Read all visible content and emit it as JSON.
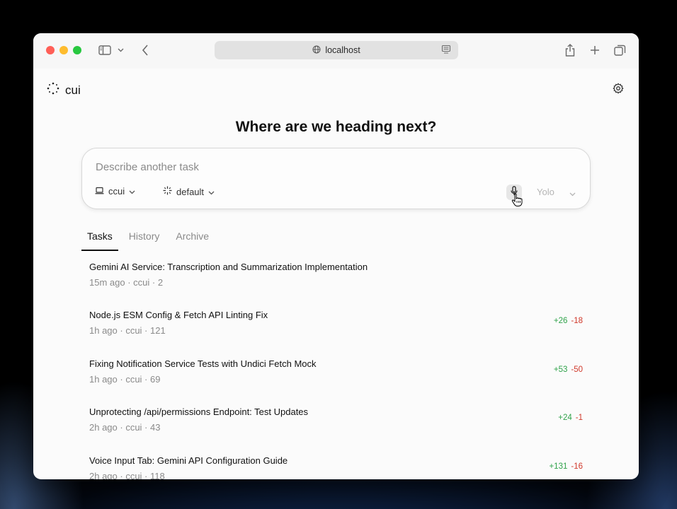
{
  "browser": {
    "url": "localhost"
  },
  "app": {
    "logo_text": "cui",
    "heading": "Where are we heading next?"
  },
  "composer": {
    "placeholder": "Describe another task",
    "project": "ccui",
    "model": "default",
    "mode": "Yolo"
  },
  "tabs": [
    "Tasks",
    "History",
    "Archive"
  ],
  "tasks": [
    {
      "title": "Gemini AI Service: Transcription and Summarization Implementation",
      "meta": "15m ago · ccui · 2",
      "additions": "",
      "deletions": ""
    },
    {
      "title": "Node.js ESM Config & Fetch API Linting Fix",
      "meta": "1h ago · ccui · 121",
      "additions": "+26",
      "deletions": "-18"
    },
    {
      "title": "Fixing Notification Service Tests with Undici Fetch Mock",
      "meta": "1h ago · ccui · 69",
      "additions": "+53",
      "deletions": "-50"
    },
    {
      "title": "Unprotecting /api/permissions Endpoint: Test Updates",
      "meta": "2h ago · ccui · 43",
      "additions": "+24",
      "deletions": "-1"
    },
    {
      "title": "Voice Input Tab: Gemini API Configuration Guide",
      "meta": "2h ago · ccui · 118",
      "additions": "+131",
      "deletions": "-16"
    }
  ],
  "colors": {
    "additions": "#2fa24a",
    "deletions": "#d0392b"
  }
}
